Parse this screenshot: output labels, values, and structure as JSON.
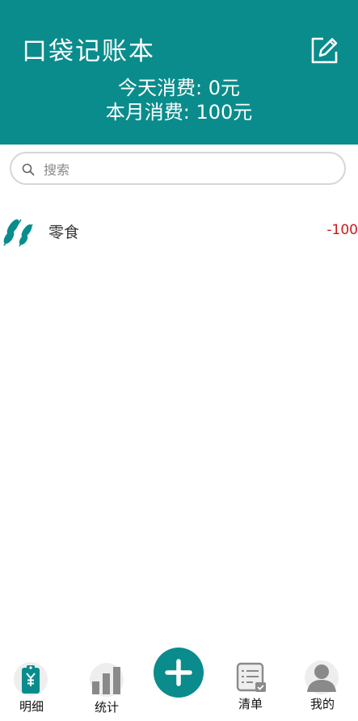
{
  "header": {
    "title": "口袋记账本",
    "today_label": "今天消费: 0元",
    "month_label": "本月消费: 100元"
  },
  "search": {
    "placeholder": "搜索",
    "value": ""
  },
  "records": [
    {
      "category": "零食",
      "amount": "-100",
      "icon": "snack-skewer-icon"
    }
  ],
  "nav": {
    "items": [
      {
        "label": "明细",
        "icon": "bill-detail-icon"
      },
      {
        "label": "统计",
        "icon": "bar-chart-icon"
      },
      {
        "label": "",
        "icon": "plus-icon"
      },
      {
        "label": "清单",
        "icon": "checklist-icon"
      },
      {
        "label": "我的",
        "icon": "user-icon"
      }
    ]
  },
  "colors": {
    "primary": "#0a8c8c",
    "expense": "#cc1a1a",
    "inactive_icon": "#888888",
    "background": "#ffffff"
  }
}
